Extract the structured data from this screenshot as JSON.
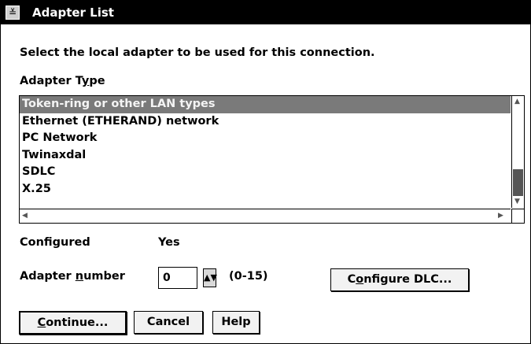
{
  "window": {
    "title": "Adapter List",
    "sysmenu_glyph": "≚"
  },
  "prompt": "Select the local adapter to be used for this connection.",
  "adapter_type": {
    "label_before": "Adapter T",
    "label_mnemonic": "y",
    "label_after": "pe",
    "items": [
      "Token-ring or other LAN types",
      "Ethernet (ETHERAND) network",
      "PC Network",
      "Twinaxdal",
      "SDLC",
      "X.25"
    ],
    "selected_index": 0
  },
  "configured": {
    "label": "Configured",
    "value": "Yes"
  },
  "adapter_number": {
    "label_before": "Adapter ",
    "label_mnemonic": "n",
    "label_after": "umber",
    "value": "0",
    "range": "(0-15)"
  },
  "buttons": {
    "configure_before": "C",
    "configure_mnemonic": "o",
    "configure_after": "nfigure DLC...",
    "continue_mnemonic": "C",
    "continue_after": "ontinue...",
    "cancel": "Cancel",
    "help": "Help"
  }
}
